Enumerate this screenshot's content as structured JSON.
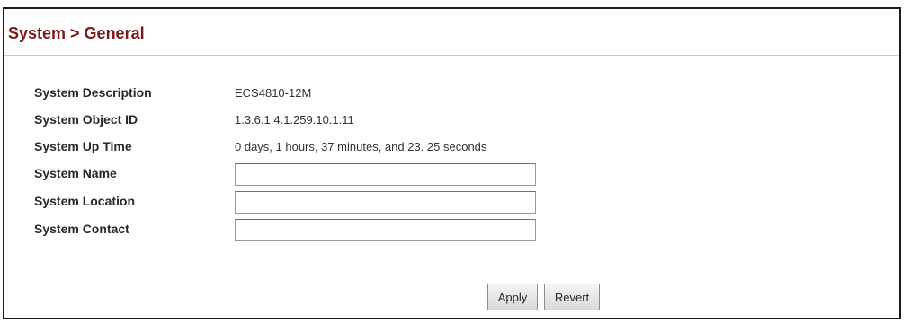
{
  "header": {
    "title": "System > General"
  },
  "info_rows": [
    {
      "label": "System Description",
      "value": "ECS4810-12M"
    },
    {
      "label": "System Object ID",
      "value": "1.3.6.1.4.1.259.10.1.11"
    },
    {
      "label": "System Up Time",
      "value": "0 days, 1 hours, 37 minutes, and 23. 25 seconds"
    }
  ],
  "input_rows": [
    {
      "label": "System Name",
      "value": ""
    },
    {
      "label": "System Location",
      "value": ""
    },
    {
      "label": "System Contact",
      "value": ""
    }
  ],
  "actions": {
    "apply_label": "Apply",
    "revert_label": "Revert"
  },
  "colors": {
    "title": "#7a1a1a",
    "frame_border": "#1a1a1a"
  }
}
